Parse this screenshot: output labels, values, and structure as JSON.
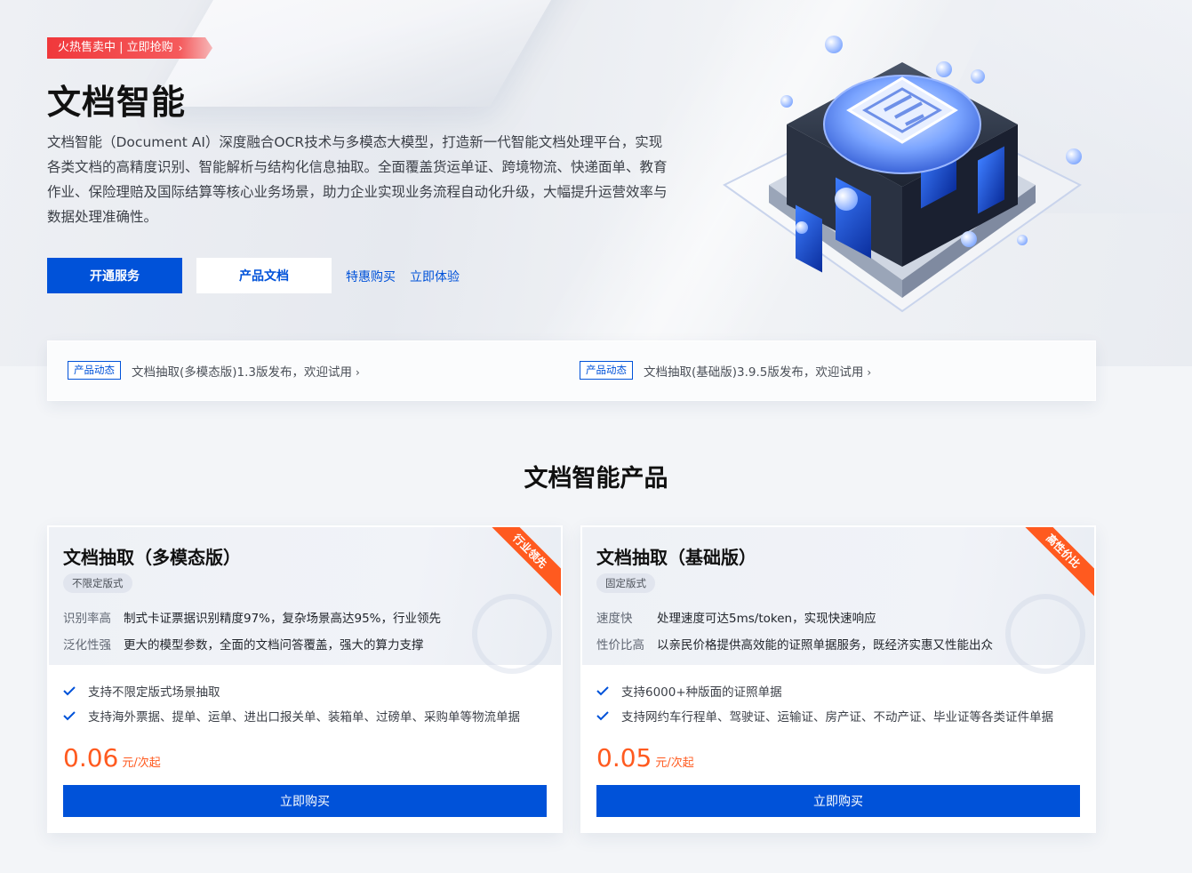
{
  "hero": {
    "promo": "火热售卖中 | 立即抢购",
    "title": "文档智能",
    "description": "文档智能（Document AI）深度融合OCR技术与多模态大模型，打造新一代智能文档处理平台，实现各类文档的高精度识别、智能解析与结构化信息抽取。全面覆盖货运单证、跨境物流、快递面单、教育作业、保险理赔及国际结算等核心业务场景，助力企业实现业务流程自动化升级，大幅提升运营效率与数据处理准确性。",
    "btn_primary": "开通服务",
    "btn_secondary": "产品文档",
    "link1": "特惠购买",
    "link2": "立即体验"
  },
  "news": [
    {
      "tag": "产品动态",
      "text": "文档抽取(多模态版)1.3版发布，欢迎试用"
    },
    {
      "tag": "产品动态",
      "text": "文档抽取(基础版)3.9.5版发布，欢迎试用"
    }
  ],
  "section_title": "文档智能产品",
  "cards": [
    {
      "title": "文档抽取（多模态版）",
      "ribbon": "行业领先",
      "badge": "不限定版式",
      "features": [
        {
          "key": "识别率高",
          "value": "制式卡证票据识别精度97%，复杂场景高达95%，行业领先"
        },
        {
          "key": "泛化性强",
          "value": "更大的模型参数，全面的文档问答覆盖，强大的算力支撑"
        }
      ],
      "checks": [
        "支持不限定版式场景抽取",
        "支持海外票据、提单、运单、进出口报关单、装箱单、过磅单、采购单等物流单据"
      ],
      "price": "0.06",
      "price_unit": "元/次起",
      "buy": "立即购买"
    },
    {
      "title": "文档抽取（基础版）",
      "ribbon": "高性价比",
      "badge": "固定版式",
      "features": [
        {
          "key": "速度快",
          "value": "处理速度可达5ms/token，实现快速响应"
        },
        {
          "key": "性价比高",
          "value": "以亲民价格提供高效能的证照单据服务，既经济实惠又性能出众"
        }
      ],
      "checks": [
        "支持6000+种版面的证照单据",
        "支持网约车行程单、驾驶证、运输证、房产证、不动产证、毕业证等各类证件单据"
      ],
      "price": "0.05",
      "price_unit": "元/次起",
      "buy": "立即购买"
    }
  ],
  "colors": {
    "primary": "#0052d9",
    "accent": "#ff5a1f",
    "promo": "#f0383b"
  }
}
